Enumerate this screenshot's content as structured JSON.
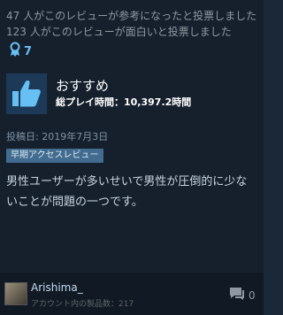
{
  "review": {
    "helpful_line": "47 人がこのレビューが参考になったと投票しました",
    "funny_line": "123 人がこのレビューが面白いと投票しました",
    "award_count": "7",
    "recommendation": "おすすめ",
    "playtime": "総プレイ時間：10,397.2時間",
    "posted": "投稿日: 2019年7月3日",
    "early_access_badge": "早期アクセスレビュー",
    "text": "男性ユーザーが多いせいで男性が圧倒的に少ないことが問題の一つです。"
  },
  "author": {
    "name": "Arishima_",
    "products": "アカウント内の製品数：217"
  },
  "comments": {
    "count": "0"
  },
  "colors": {
    "background": "#16202d",
    "accent": "#66c0f4",
    "thumb_bg": "#1c3a57",
    "badge_bg": "#416c90"
  }
}
